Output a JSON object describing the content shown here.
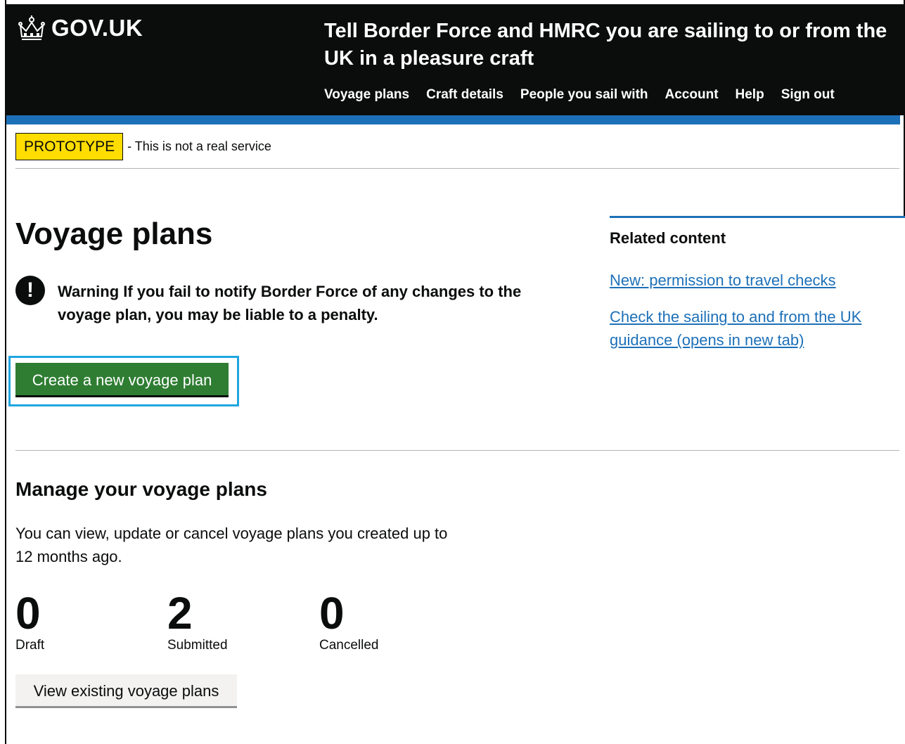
{
  "header": {
    "logo_text": "GOV.UK",
    "service_name": "Tell Border Force and HMRC you are sailing to or from the UK in a pleasure craft",
    "nav": [
      "Voyage plans",
      "Craft details",
      "People you sail with",
      "Account",
      "Help",
      "Sign out"
    ]
  },
  "phase_banner": {
    "tag": "PROTOTYPE",
    "text": "- This is not a real service"
  },
  "main": {
    "title": "Voyage plans",
    "warning": {
      "icon": "!",
      "text": "Warning If you fail to notify Border Force of any changes to the voyage plan, you may be liable to a penalty."
    },
    "create_button": "Create a new voyage plan",
    "manage": {
      "title": "Manage your voyage plans",
      "body": "You can view, update or cancel voyage plans you created up to 12 months ago.",
      "stats": [
        {
          "count": "0",
          "label": "Draft"
        },
        {
          "count": "2",
          "label": "Submitted"
        },
        {
          "count": "0",
          "label": "Cancelled"
        }
      ],
      "view_button": "View existing voyage plans"
    }
  },
  "sidebar": {
    "title": "Related content",
    "links": [
      "New: permission to travel checks",
      "Check the sailing to and from the UK guidance (opens in new tab)"
    ]
  },
  "colors": {
    "header_bg": "#0b0c0c",
    "accent_blue": "#1d70b8",
    "phase_yellow": "#ffdd00",
    "primary_green": "#2e7d32",
    "focus_ring": "#1fa5e0"
  },
  "icons": {
    "logo": "crown-icon",
    "warning": "exclamation-icon"
  }
}
